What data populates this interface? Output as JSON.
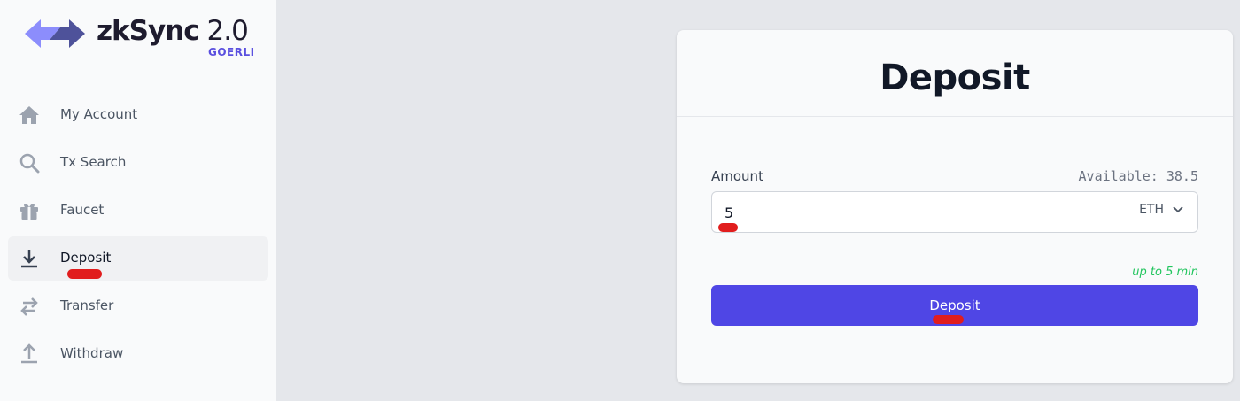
{
  "logo": {
    "brand": "zkSync",
    "version": "2.0",
    "network": "GOERLI"
  },
  "sidebar": {
    "items": [
      {
        "label": "My Account",
        "icon": "home-icon"
      },
      {
        "label": "Tx Search",
        "icon": "search-icon"
      },
      {
        "label": "Faucet",
        "icon": "gift-icon"
      },
      {
        "label": "Deposit",
        "icon": "download-icon",
        "active": true
      },
      {
        "label": "Transfer",
        "icon": "transfer-icon"
      },
      {
        "label": "Withdraw",
        "icon": "upload-icon"
      }
    ]
  },
  "deposit": {
    "title": "Deposit",
    "amount_label": "Amount",
    "available": "Available: 38.5",
    "amount_value": "5",
    "token": "ETH",
    "eta": "up to 5 min",
    "button_label": "Deposit"
  },
  "colors": {
    "accent": "#4f46e5",
    "network": "#5a4fdf",
    "eta": "#22c55e",
    "annotation": "#e11d1d"
  }
}
